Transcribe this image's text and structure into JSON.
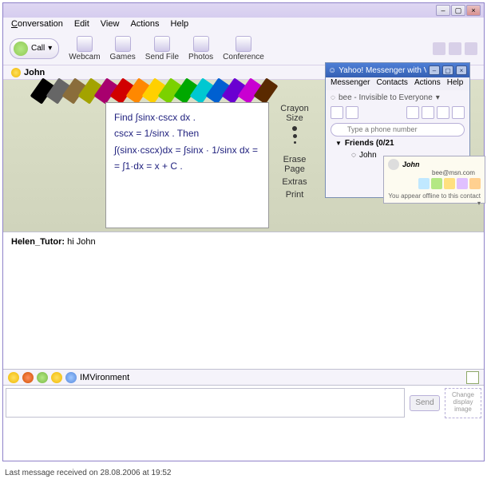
{
  "mainWindow": {
    "menus": {
      "m1": "Conversation",
      "m2": "Edit",
      "m3": "View",
      "m4": "Actions",
      "m5": "Help"
    },
    "toolbar": {
      "call": "Call",
      "webcam": "Webcam",
      "games": "Games",
      "sendfile": "Send File",
      "photos": "Photos",
      "conference": "Conference"
    },
    "contact": "John",
    "board": {
      "lines": {
        "l1": "Find  ∫sinx·cscx dx .",
        "l2": "cscx = 1/sinx .   Then",
        "l3": "∫(sinx·cscx)dx = ∫sinx · 1/sinx dx =",
        "l4": "= ∫1·dx = x + C ."
      },
      "controls": {
        "crayonSize": "Crayon Size",
        "erasePage": "Erase Page",
        "extras": "Extras",
        "print": "Print"
      }
    },
    "crayonColors": [
      "#000",
      "#666",
      "#8a6d3b",
      "#a3a300",
      "#a8006e",
      "#d10000",
      "#ff8800",
      "#ffd000",
      "#7bd100",
      "#00a800",
      "#00c8d1",
      "#0060d1",
      "#6a00d1",
      "#c900d1",
      "#5a2a00"
    ],
    "chat": {
      "sender": "Helen_Tutor:",
      "msg": " hi John"
    },
    "emobar": {
      "imvLabel": "IMVironment"
    },
    "input": {
      "send": "Send",
      "placeholder": "",
      "changeImage": "Change display image"
    },
    "status": "Last message received on 28.08.2006 at 19:52"
  },
  "ym": {
    "title": "Yahoo! Messenger with Voice (BETA)",
    "menus": {
      "m1": "Messenger",
      "m2": "Contacts",
      "m3": "Actions",
      "m4": "Help"
    },
    "status": "bee - Invisible to Everyone",
    "phonePH": "Type a phone number",
    "friendsHeader": "Friends (0/21",
    "friend": "John"
  },
  "tip": {
    "name": "John",
    "email": "bee@msn.com",
    "offline": "You appear offline to this contact"
  }
}
